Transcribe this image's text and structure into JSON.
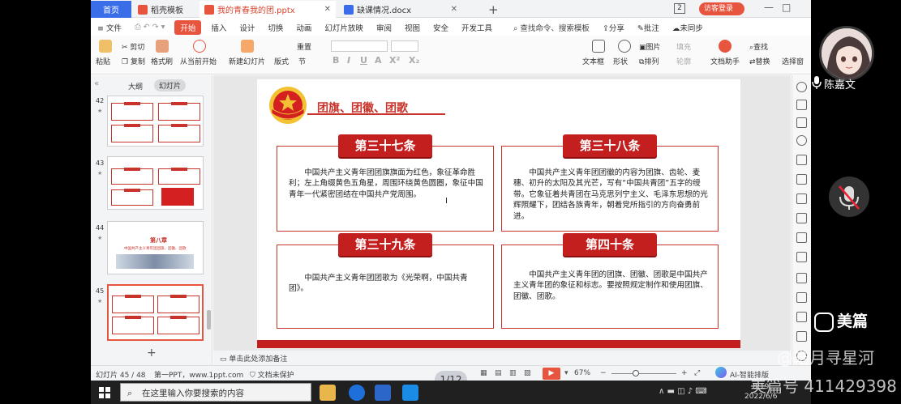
{
  "tabs": [
    {
      "label": "首页"
    },
    {
      "label": "稻壳模板"
    },
    {
      "label": "我的青春我的团.pptx"
    },
    {
      "label": "缺课情况.docx"
    }
  ],
  "titlebar": {
    "plus": "+",
    "count": "2",
    "visitor": "访客登录",
    "min": "—",
    "max": "□"
  },
  "menu": {
    "file": "≡ 文件",
    "items": [
      "开始",
      "插入",
      "设计",
      "切换",
      "动画",
      "幻灯片放映",
      "审阅",
      "视图",
      "安全",
      "开发工具"
    ],
    "search": "查找命令、搜索模板",
    "share": "分享",
    "comment": "批注",
    "sync": "未同步"
  },
  "ribbon": {
    "paste": "粘贴",
    "cut": "剪切",
    "copy": "复制",
    "format_painter": "格式刷",
    "from_current": "从当前开始",
    "new_slide": "新建幻灯片",
    "layout": "版式",
    "section": "节",
    "reset": "重置",
    "textbox": "文本框",
    "shape": "形状",
    "picture": "图片",
    "arrange": "排列",
    "fill": "填充",
    "outline": "轮廓",
    "doc_assistant": "文档助手",
    "find": "查找",
    "replace": "替换",
    "select": "选择窗"
  },
  "sidebar": {
    "collapse": "«",
    "outline": "大纲",
    "slides": "幻灯片",
    "add": "+"
  },
  "thumbs": [
    {
      "num": "42"
    },
    {
      "num": "43"
    },
    {
      "num": "44"
    },
    {
      "num": "45"
    }
  ],
  "thumb44": {
    "title": "第八章",
    "subtitle": "中国共产主义青年团团旗、团徽、团歌"
  },
  "slide": {
    "title": "团旗、团徽、团歌",
    "articles": [
      {
        "head": "第三十七条",
        "text": "中国共产主义青年团团旗旗面为红色，象征革命胜利；左上角缀黄色五角星，周围环绕黄色圆圈，象征中国青年一代紧密团结在中国共产党周围。"
      },
      {
        "head": "第三十八条",
        "text": "中国共产主义青年团团徽的内容为团旗、齿轮、麦穗、初升的太阳及其光芒，写有“中国共青团”五字的绶带。它象征着共青团在马克思列宁主义、毛泽东思想的光辉照耀下，团结各族青年，朝着党所指引的方向奋勇前进。"
      },
      {
        "head": "第三十九条",
        "text": "中国共产主义青年团团歌为《光荣啊，中国共青团》。"
      },
      {
        "head": "第四十条",
        "text": "中国共产主义青年团的团旗、团徽、团歌是中国共产主义青年团的象征和标志。要按照规定制作和使用团旗、团徽、团歌。"
      }
    ]
  },
  "notes": "单击此处添加备注",
  "status": {
    "slide_count": "幻灯片 45 / 48",
    "theme": "第一PPT，www.1ppt.com",
    "doc_protect": "文档未保护",
    "page_badge": "1/12",
    "zoom": "67%",
    "ai_layout": "AI-智能排版"
  },
  "taskbar": {
    "search": "在这里输入你要搜索的内容",
    "time": "8:19",
    "date": "2022/6/6"
  },
  "user": {
    "name": "陈嘉文",
    "meipian": "美篇"
  },
  "watermark": {
    "line1": "@皓月寻星河",
    "line2": "美篇号 411429398"
  }
}
